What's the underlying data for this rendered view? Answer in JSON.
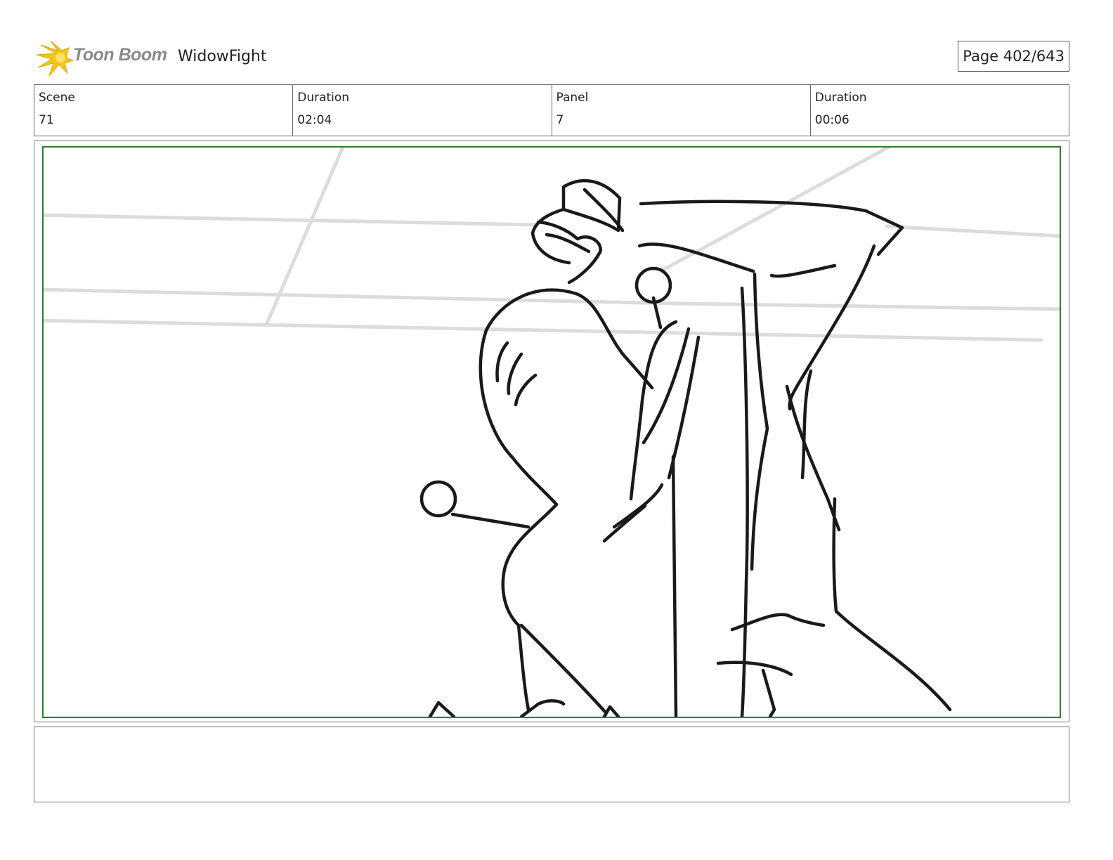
{
  "header": {
    "logo_text": "Toon Boom",
    "project_title": "WidowFight",
    "page_label": "Page 402/643"
  },
  "info": {
    "scene_label": "Scene",
    "scene_value": "71",
    "scene_duration_label": "Duration",
    "scene_duration_value": "02:04",
    "panel_label": "Panel",
    "panel_value": "7",
    "panel_duration_label": "Duration",
    "panel_duration_value": "00:06"
  },
  "panel": {
    "safe_area_color": "#2e7d32",
    "sketch_icon": "storyboard-sketch"
  },
  "notes": {
    "text": ""
  }
}
